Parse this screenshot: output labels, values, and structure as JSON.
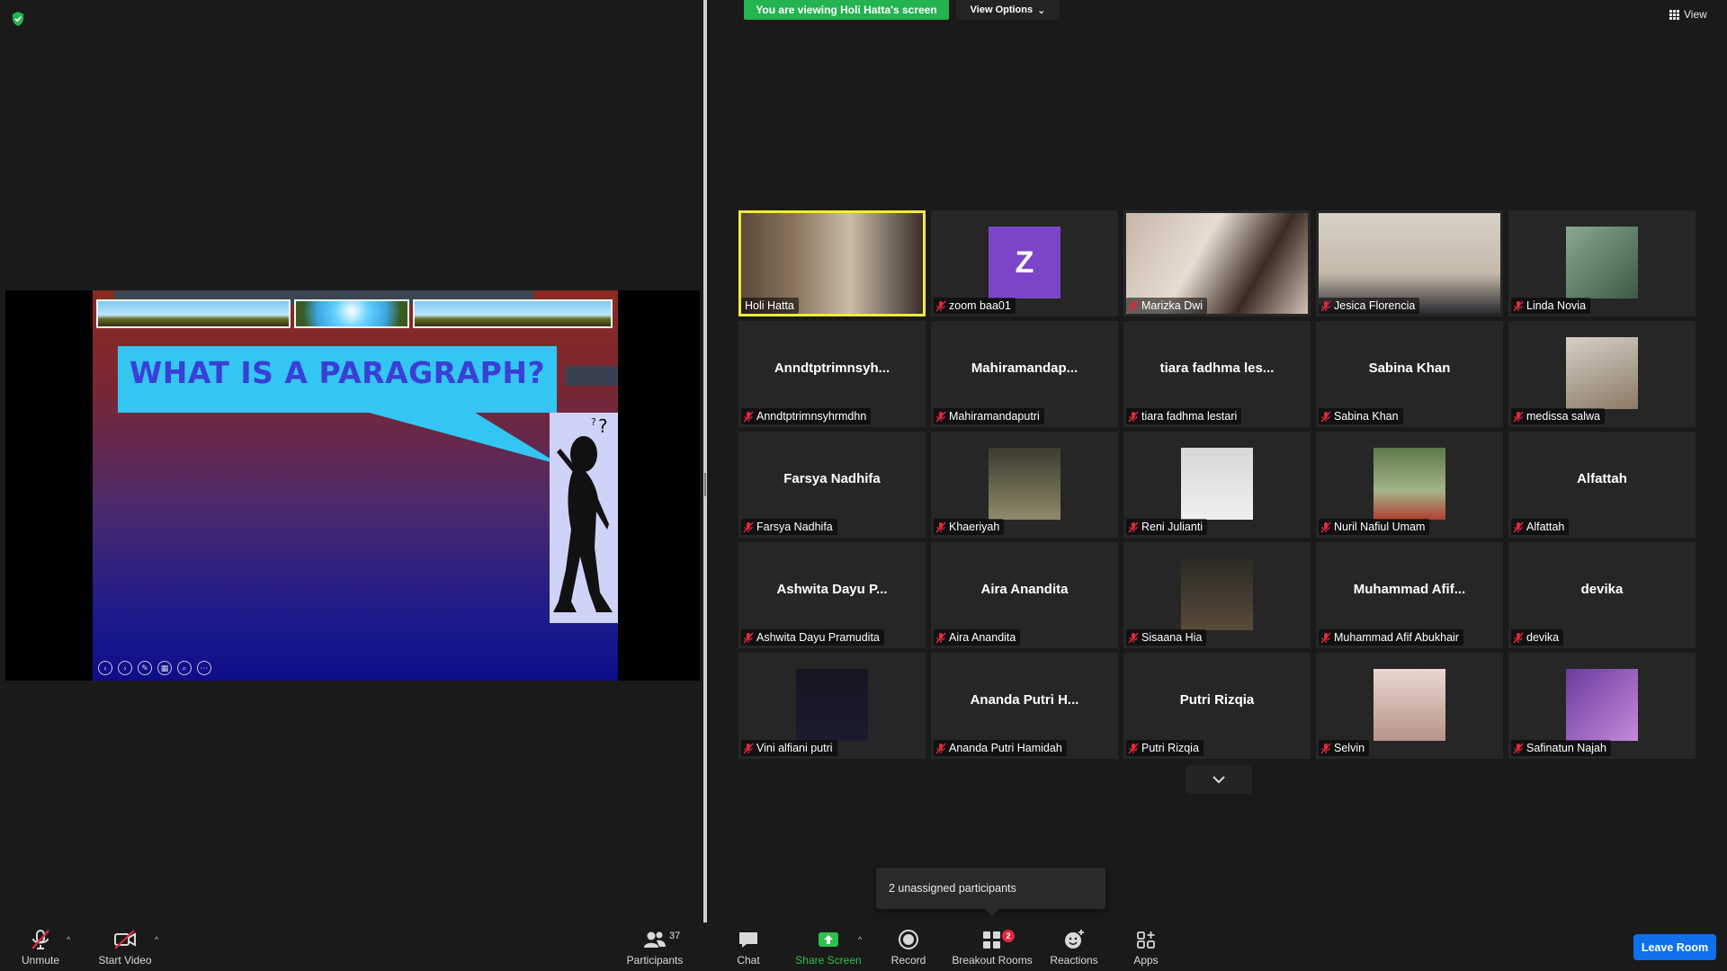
{
  "share": {
    "slide_title": "WHAT IS A PARAGRAPH?"
  },
  "banner": {
    "viewing_text": "You are viewing Holi Hatta's screen",
    "view_options_label": "View Options"
  },
  "view_label": "View",
  "participants": [
    {
      "name": "Holi Hatta",
      "display": "video",
      "muted": false,
      "active_speaker": true
    },
    {
      "name": "zoom baa01",
      "display": "avatar",
      "avatar_letter": "Z",
      "avatar_color": "#7c45c8",
      "muted": true
    },
    {
      "name": "Marizka Dwi",
      "display": "video",
      "muted": true
    },
    {
      "name": "Jesica Florencia",
      "display": "video",
      "muted": true
    },
    {
      "name": "Linda Novia",
      "display": "photo",
      "muted": true
    },
    {
      "name": "Anndtptrimnsyhrmdhn",
      "big_name": "Anndtptrimnsyh...",
      "display": "name",
      "muted": true
    },
    {
      "name": "Mahiramandaputri",
      "big_name": "Mahiramandap...",
      "display": "name",
      "muted": true
    },
    {
      "name": "tiara fadhma lestari",
      "big_name": "tiara fadhma les...",
      "display": "name",
      "muted": true
    },
    {
      "name": "Sabina Khan",
      "big_name": "Sabina Khan",
      "display": "name",
      "muted": true
    },
    {
      "name": "medissa salwa",
      "display": "photo",
      "muted": true
    },
    {
      "name": "Farsya Nadhifa",
      "big_name": "Farsya Nadhifa",
      "display": "name",
      "muted": true
    },
    {
      "name": "Khaeriyah",
      "display": "photo",
      "muted": true
    },
    {
      "name": "Reni Julianti",
      "display": "photo",
      "muted": true
    },
    {
      "name": "Nuril Nafiul Umam",
      "display": "photo",
      "muted": true
    },
    {
      "name": "Alfattah",
      "big_name": "Alfattah",
      "display": "name",
      "muted": true
    },
    {
      "name": "Ashwita Dayu Pramudita",
      "big_name": "Ashwita Dayu P...",
      "display": "name",
      "muted": true
    },
    {
      "name": "Aira Anandita",
      "big_name": "Aira Anandita",
      "display": "name",
      "muted": true
    },
    {
      "name": "Sisaana Hia",
      "display": "photo",
      "muted": true
    },
    {
      "name": "Muhammad Afif Abukhair",
      "big_name": "Muhammad Afif...",
      "display": "name",
      "muted": true
    },
    {
      "name": "devika",
      "big_name": "devika",
      "display": "name",
      "muted": true
    },
    {
      "name": "Vini alfiani putri",
      "display": "photo",
      "muted": true
    },
    {
      "name": "Ananda Putri Hamidah",
      "big_name": "Ananda Putri H...",
      "display": "name",
      "muted": true
    },
    {
      "name": "Putri Rizqia",
      "big_name": "Putri Rizqia",
      "display": "name",
      "muted": true
    },
    {
      "name": "Selvin",
      "display": "photo",
      "muted": true
    },
    {
      "name": "Safinatun Najah",
      "display": "photo",
      "muted": true
    }
  ],
  "toast": {
    "text": "2 unassigned participants"
  },
  "toolbar": {
    "unmute": "Unmute",
    "start_video": "Start Video",
    "participants": "Participants",
    "participants_count": "37",
    "chat": "Chat",
    "share_screen": "Share Screen",
    "record": "Record",
    "breakout_rooms": "Breakout Rooms",
    "breakout_badge": "2",
    "reactions": "Reactions",
    "apps": "Apps",
    "leave_room": "Leave Room"
  },
  "colors": {
    "banner_green": "#23b351",
    "active_speaker_border": "#f2ea3a",
    "leave_blue": "#0e71eb",
    "muted_red": "#e0283c",
    "share_green": "#2fbf4f"
  }
}
